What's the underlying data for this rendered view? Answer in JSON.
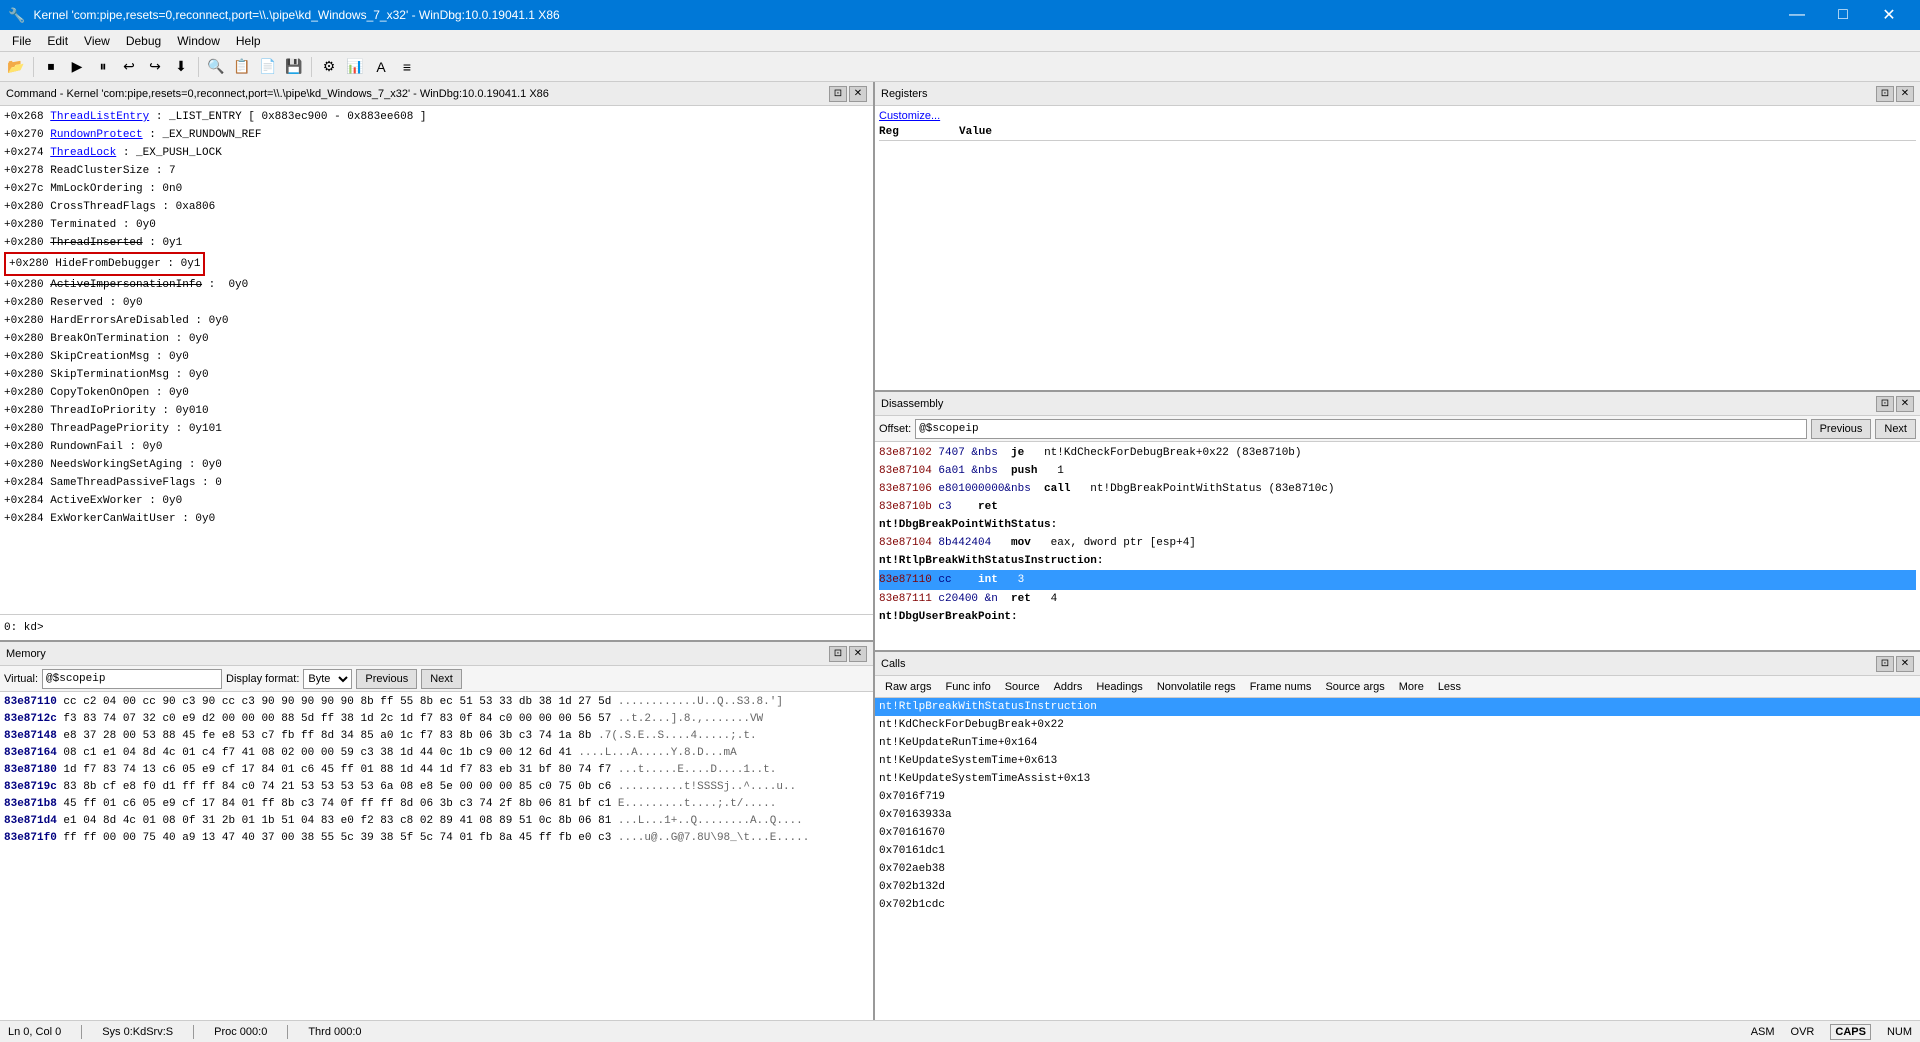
{
  "titleBar": {
    "title": "Kernel 'com:pipe,resets=0,reconnect,port=\\\\.\\pipe\\kd_Windows_7_x32' - WinDbg:10.0.19041.1 X86",
    "minimize": "—",
    "maximize": "□",
    "close": "✕"
  },
  "menuBar": {
    "items": [
      "File",
      "Edit",
      "View",
      "Debug",
      "Window",
      "Help"
    ]
  },
  "commandPanel": {
    "title": "Command - Kernel 'com:pipe,resets=0,reconnect,port=\\\\.\\pipe\\kd_Windows_7_x32' - WinDbg:10.0.19041.1 X86",
    "codeLines": [
      "+0x268 ThreadListEntry   :  _LIST_ENTRY [ 0x883ec900 - 0x883ee608 ]",
      "+0x270 RundownProtect    :  _EX_RUNDOWN_REF",
      "+0x274 ThreadLock        :  _EX_PUSH_LOCK",
      "+0x278 ReadClusterSize   :  7",
      "+0x27c MmLockOrdering    :  0n0",
      "+0x280 CrossThreadFlags  :  0xa806",
      "+0x280 Terminated        :  0y0",
      "+0x280 ThreadInserted    :  0y1",
      "+0x280 HideFromDebugger  :  0y1",
      "+0x280 ActiveImpersonationInfo : 0y0",
      "+0x280 Reserved          :  0y0",
      "+0x280 HardErrorsAreDisabled : 0y0",
      "+0x280 BreakOnTermination : 0y0",
      "+0x280 SkipCreationMsg   :  0y0",
      "+0x280 SkipTerminationMsg : 0y0",
      "+0x280 CopyTokenOnOpen   :  0y0",
      "+0x280 ThreadIoPriority  :  0y010",
      "+0x280 ThreadPagePriority : 0y101",
      "+0x280 RundownFail       :  0y0",
      "+0x280 NeedsWorkingSetAging : 0y0",
      "+0x284 SameThreadPassiveFlags : 0",
      "+0x284 ActiveExWorker    :  0y0",
      "+0x284 ExWorkerCanWaitUser : 0y0"
    ],
    "commandPrompt": "0: kd> "
  },
  "registersPanel": {
    "title": "Registers",
    "customize": "Customize...",
    "headers": [
      "Reg",
      "Value"
    ]
  },
  "disassemblyPanel": {
    "title": "Disassembly",
    "offsetLabel": "Offset:",
    "offsetValue": "@$scopeip",
    "prevButton": "Previous",
    "nextButton": "Next",
    "lines": [
      {
        "addr": "83e87102",
        "bytes": "7407",
        "mnemonic": "je",
        "operand": "nt!KdCheckForDebugBreak+0x22 (83e8710b)"
      },
      {
        "addr": "83e87104",
        "bytes": "6a01",
        "mnemonic": "push",
        "operand": "1"
      },
      {
        "addr": "83e87106",
        "bytes": "e801000000",
        "mnemonic": "call",
        "operand": "nt!DbgBreakPointWithStatus (83e8710c)"
      },
      {
        "addr": "83e8710b",
        "bytes": "c3",
        "mnemonic": "ret",
        "operand": ""
      },
      {
        "label": "nt!DbgBreakPointWithStatus:",
        "addr": "",
        "bytes": "",
        "mnemonic": "",
        "operand": ""
      },
      {
        "addr": "83e87104",
        "bytes": "8b442404",
        "mnemonic": "mov",
        "operand": "eax, dword ptr [esp+4]"
      },
      {
        "label": "nt!RtlpBreakWithStatusInstruction:",
        "addr": "",
        "bytes": "",
        "mnemonic": "",
        "operand": ""
      },
      {
        "addr": "83e87110",
        "bytes": "cc",
        "mnemonic": "int",
        "operand": "3",
        "highlighted": true
      },
      {
        "addr": "83e87111",
        "bytes": "c20400",
        "mnemonic": "ret",
        "operand": "4"
      },
      {
        "label": "nt!DbgUserBreakPoint:",
        "addr": "",
        "bytes": "",
        "mnemonic": "",
        "operand": ""
      }
    ]
  },
  "memoryPanel": {
    "title": "Memory",
    "virtualLabel": "Virtual:",
    "virtualValue": "@$scopeip",
    "displayFormatLabel": "Display format:",
    "displayFormat": "Byte",
    "prevButton": "Previous",
    "nextButton": "Next",
    "lines": [
      {
        "addr": "83e87110",
        "hex": "cc c2 04 00 cc 90 c3 90 cc c3 90 90 90 90 90 8b ff 55 8b ec 51 53 33 db 38 1d 27 5d",
        "ascii": "............U..Q..S3.8.']"
      },
      {
        "addr": "83e8712c",
        "hex": "f3 83 74 07 32 c0 e9 d2 00 00 00 88 5d ff 38 1d 2c 1d f7 83 0f 84 c0 00 00 00 56 57",
        "ascii": "..t.2...].8.,.......VW"
      },
      {
        "addr": "83e87148",
        "hex": "e8 37 28 00 53 88 45 fe e8 53 c7 fb ff 8d 34 85 a0 1c f7 83 8b 06 3b c3 74 1a 8b",
        "ascii": ".7(.S.E..S....4.....;.t."
      },
      {
        "addr": "83e87164",
        "hex": "08 c1 e1 04 8d 4c 01 c4 f7 41 08 02 00 00 59 c3 38 1d 44 0c 1b c9 00 12 6d 41",
        "ascii": "....L...A.....Y.8.D...mA"
      },
      {
        "addr": "83e87180",
        "hex": "1d f7 83 74 13 c6 05 e9 cf 17 84 01 c6 45 ff 01 88 1d 44 1d f7 83 eb 31 bf 80 74 f7",
        "ascii": "...t.....E....D....1..t."
      },
      {
        "addr": "83e8719c",
        "hex": "83 8b cf e8 f0 d1 ff ff 84 c0 74 21 53 53 53 53 6a 08 e8 5e 00 00 00 85 c0 75 0b c6",
        "ascii": "..........t!SSSSj..^....u.."
      },
      {
        "addr": "83e871b8",
        "hex": "45 ff 01 c6 05 e9 cf 17 84 01 ff 8b c3 74 0f ff ff 8d 06 3b c3 74 2f 8b 06 81 bf c1",
        "ascii": "E.........t....;.t/....."
      },
      {
        "addr": "83e871d4",
        "hex": "e1 04 8d 4c 01 08 0f 31 2b 01 1b 51 04 83 e0 f2 83 c8 02 89 41 08 89 51 0c 8b 06 81",
        "ascii": "...L...1+..Q........A..Q...."
      },
      {
        "addr": "83e871f0",
        "hex": "ff ff 00 00 75 40 a9 13 47 40 37 00 38 55 5c 39 38 5f 5c 74 01 fb 8a 45 ff fb e0 c3",
        "ascii": "....u@..G@7.8U\\98_\\t...E....."
      }
    ]
  },
  "callsPanel": {
    "title": "Calls",
    "tabs": [
      "Raw args",
      "Func info",
      "Source",
      "Addrs",
      "Headings",
      "Nonvolatile regs",
      "Frame nums",
      "Source args",
      "More",
      "Less"
    ],
    "lines": [
      {
        "text": "nt!RtlpBreakWithStatusInstruction",
        "selected": true
      },
      {
        "text": "nt!KdCheckForDebugBreak+0x22"
      },
      {
        "text": "nt!KeUpdateRunTime+0x164"
      },
      {
        "text": "nt!KeUpdateSystemTime+0x613"
      },
      {
        "text": "nt!KeUpdateSystemTimeAssist+0x13"
      },
      {
        "text": "0x7016f719"
      },
      {
        "text": "0x70163933a"
      },
      {
        "text": "0x70161670"
      },
      {
        "text": "0x70161dc1"
      },
      {
        "text": "0x702aeb38"
      },
      {
        "text": "0x702b132d"
      },
      {
        "text": "0x702b1cdc"
      }
    ]
  },
  "statusBar": {
    "lnCol": "Ln 0, Col 0",
    "sys": "Sys 0:KdSrv:S",
    "proc": "Proc 000:0",
    "thrd": "Thrd 000:0",
    "asm": "ASM",
    "ovr": "OVR",
    "caps": "CAPS",
    "num": "NUM"
  }
}
